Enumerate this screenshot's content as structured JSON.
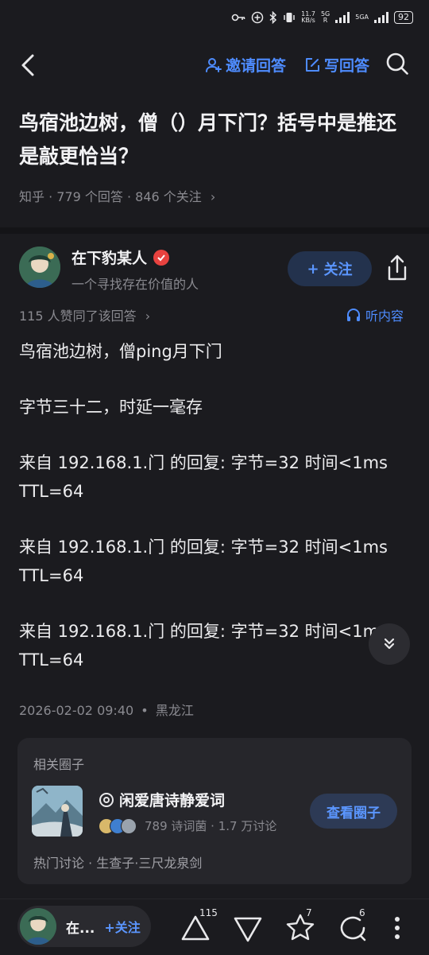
{
  "status_bar": {
    "speed_value": "11.7",
    "speed_unit": "KB/s",
    "network_1": "5G",
    "network_1_sub": "R",
    "network_2": "5GA",
    "battery": "92"
  },
  "nav": {
    "invite_label": "邀请回答",
    "write_label": "写回答"
  },
  "question": {
    "title": "鸟宿池边树，僧（）月下门？括号中是推还是敲更恰当？",
    "meta": "知乎 · 779 个回答 · 846 个关注",
    "meta_chevron": "›"
  },
  "author": {
    "name": "在下豹某人",
    "bio": "一个寻找存在价值的人",
    "follow_label": "关注",
    "follow_plus": "+"
  },
  "answer": {
    "likes_line": "115 人赞同了该回答",
    "likes_chevron": "›",
    "listen_label": "听内容",
    "paragraphs": [
      "鸟宿池边树，僧ping月下门",
      "字节三十二，时延一毫存",
      "来自 192.168.1.门 的回复: 字节=32 时间<1ms TTL=64",
      "来自 192.168.1.门 的回复: 字节=32 时间<1ms TTL=64",
      "来自 192.168.1.门 的回复: 字节=32 时间<1ms TTL=64"
    ],
    "datetime": "2026-02-02 09:40",
    "location": "黑龙江",
    "meta_separator": "•"
  },
  "related_circle": {
    "header": "相关圈子",
    "name": "闲爱唐诗静爱词",
    "stats": "789 诗词菌 · 1.7 万讨论",
    "view_label": "查看圈子",
    "hot_topics": "热门讨论 · 生查子·三尺龙泉剑"
  },
  "bottom_bar": {
    "author_short": "在...",
    "follow_label": "+关注",
    "upvote_count": "115",
    "star_count": "7",
    "comment_count": "6"
  },
  "colors": {
    "background": "#1b1b1f",
    "accent": "#4e8cff",
    "badge": "#e8423f"
  }
}
